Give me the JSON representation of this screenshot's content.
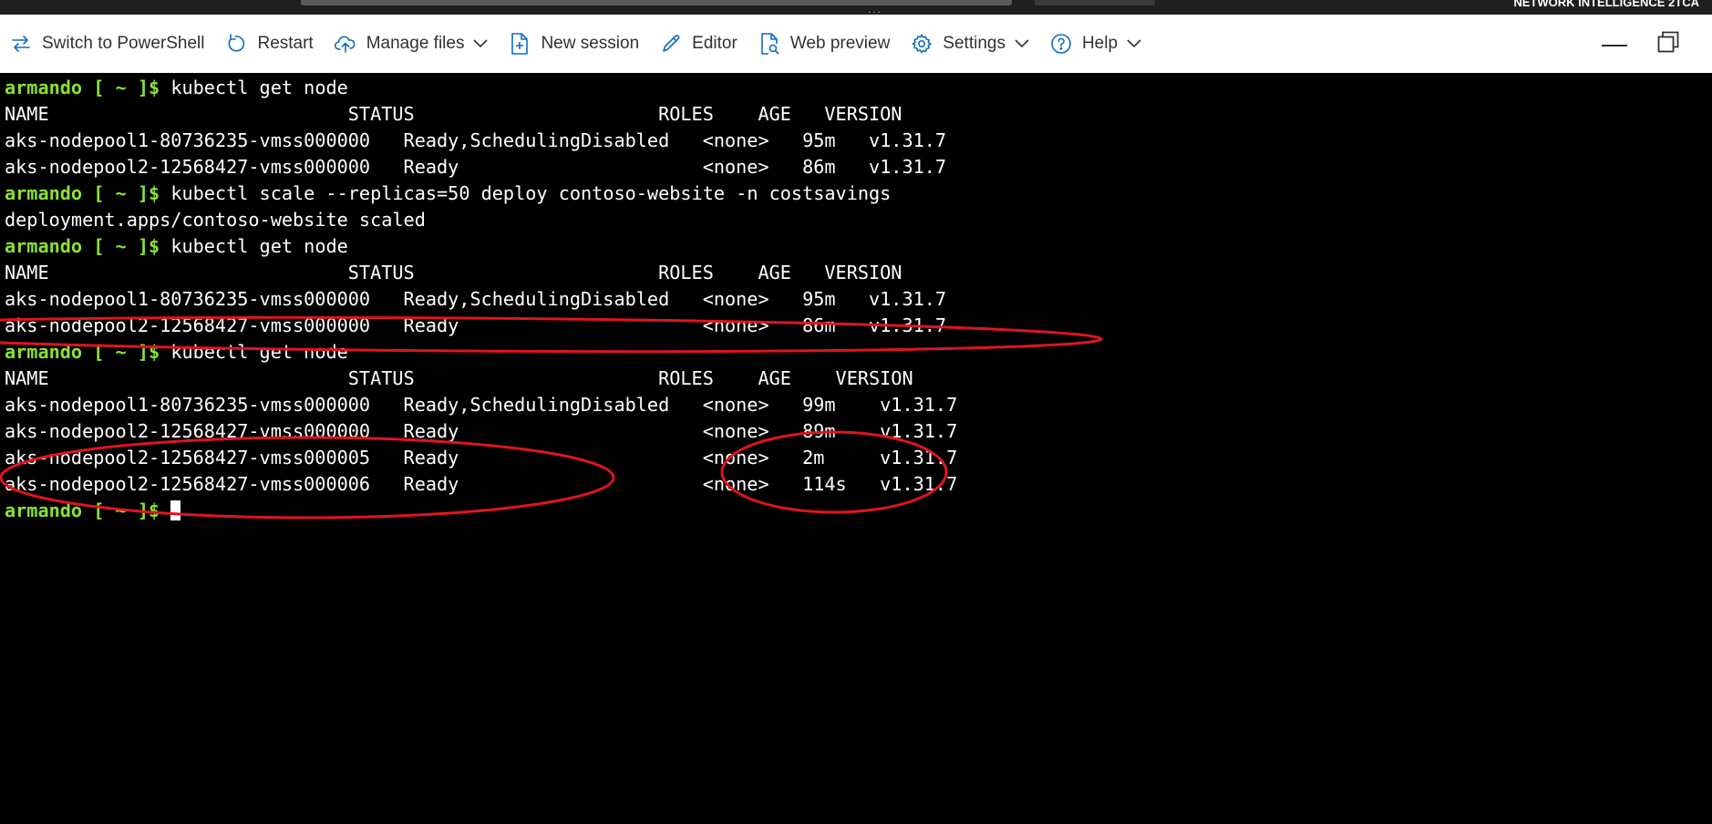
{
  "window": {
    "brand": "NETWORK INTELLIGENCE 2TCA",
    "dots": "..."
  },
  "toolbar": {
    "switch_label": "Switch to PowerShell",
    "restart_label": "Restart",
    "manage_files_label": "Manage files",
    "new_session_label": "New session",
    "editor_label": "Editor",
    "web_preview_label": "Web preview",
    "settings_label": "Settings",
    "help_label": "Help"
  },
  "terminal": {
    "prompt": {
      "user": "armando",
      "dir": " [ ~ ]$ "
    },
    "lines": [
      {
        "type": "prompt",
        "cmd": "kubectl get node"
      },
      {
        "type": "out",
        "text": "NAME                           STATUS                      ROLES    AGE   VERSION"
      },
      {
        "type": "out",
        "text": "aks-nodepool1-80736235-vmss000000   Ready,SchedulingDisabled   <none>   95m   v1.31.7"
      },
      {
        "type": "out",
        "text": "aks-nodepool2-12568427-vmss000000   Ready                      <none>   86m   v1.31.7"
      },
      {
        "type": "prompt",
        "cmd": "kubectl scale --replicas=50 deploy contoso-website -n costsavings"
      },
      {
        "type": "out",
        "text": "deployment.apps/contoso-website scaled"
      },
      {
        "type": "prompt",
        "cmd": "kubectl get node"
      },
      {
        "type": "out",
        "text": "NAME                           STATUS                      ROLES    AGE   VERSION"
      },
      {
        "type": "out",
        "text": "aks-nodepool1-80736235-vmss000000   Ready,SchedulingDisabled   <none>   95m   v1.31.7"
      },
      {
        "type": "out",
        "text": "aks-nodepool2-12568427-vmss000000   Ready                      <none>   86m   v1.31.7"
      },
      {
        "type": "prompt",
        "cmd": "kubectl get node"
      },
      {
        "type": "out",
        "text": "NAME                           STATUS                      ROLES    AGE    VERSION"
      },
      {
        "type": "out",
        "text": "aks-nodepool1-80736235-vmss000000   Ready,SchedulingDisabled   <none>   99m    v1.31.7"
      },
      {
        "type": "out",
        "text": "aks-nodepool2-12568427-vmss000000   Ready                      <none>   89m    v1.31.7"
      },
      {
        "type": "out",
        "text": "aks-nodepool2-12568427-vmss000005   Ready                      <none>   2m     v1.31.7"
      },
      {
        "type": "out",
        "text": "aks-nodepool2-12568427-vmss000006   Ready                      <none>   114s   v1.31.7"
      },
      {
        "type": "prompt",
        "cmd": ""
      }
    ]
  },
  "colors": {
    "prompt_green": "#8ae234",
    "annotation_red": "#e0141e",
    "toolbar_icon_blue": "#0f6cbd"
  }
}
